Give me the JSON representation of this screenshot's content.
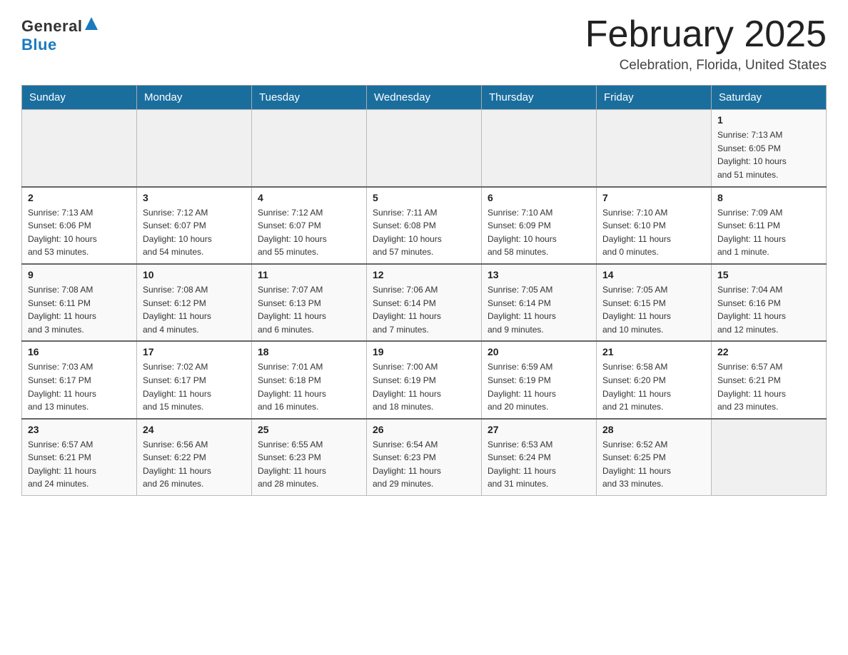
{
  "logo": {
    "general": "General",
    "blue": "Blue"
  },
  "header": {
    "month": "February 2025",
    "location": "Celebration, Florida, United States"
  },
  "days_of_week": [
    "Sunday",
    "Monday",
    "Tuesday",
    "Wednesday",
    "Thursday",
    "Friday",
    "Saturday"
  ],
  "weeks": [
    [
      {
        "day": "",
        "info": ""
      },
      {
        "day": "",
        "info": ""
      },
      {
        "day": "",
        "info": ""
      },
      {
        "day": "",
        "info": ""
      },
      {
        "day": "",
        "info": ""
      },
      {
        "day": "",
        "info": ""
      },
      {
        "day": "1",
        "info": "Sunrise: 7:13 AM\nSunset: 6:05 PM\nDaylight: 10 hours\nand 51 minutes."
      }
    ],
    [
      {
        "day": "2",
        "info": "Sunrise: 7:13 AM\nSunset: 6:06 PM\nDaylight: 10 hours\nand 53 minutes."
      },
      {
        "day": "3",
        "info": "Sunrise: 7:12 AM\nSunset: 6:07 PM\nDaylight: 10 hours\nand 54 minutes."
      },
      {
        "day": "4",
        "info": "Sunrise: 7:12 AM\nSunset: 6:07 PM\nDaylight: 10 hours\nand 55 minutes."
      },
      {
        "day": "5",
        "info": "Sunrise: 7:11 AM\nSunset: 6:08 PM\nDaylight: 10 hours\nand 57 minutes."
      },
      {
        "day": "6",
        "info": "Sunrise: 7:10 AM\nSunset: 6:09 PM\nDaylight: 10 hours\nand 58 minutes."
      },
      {
        "day": "7",
        "info": "Sunrise: 7:10 AM\nSunset: 6:10 PM\nDaylight: 11 hours\nand 0 minutes."
      },
      {
        "day": "8",
        "info": "Sunrise: 7:09 AM\nSunset: 6:11 PM\nDaylight: 11 hours\nand 1 minute."
      }
    ],
    [
      {
        "day": "9",
        "info": "Sunrise: 7:08 AM\nSunset: 6:11 PM\nDaylight: 11 hours\nand 3 minutes."
      },
      {
        "day": "10",
        "info": "Sunrise: 7:08 AM\nSunset: 6:12 PM\nDaylight: 11 hours\nand 4 minutes."
      },
      {
        "day": "11",
        "info": "Sunrise: 7:07 AM\nSunset: 6:13 PM\nDaylight: 11 hours\nand 6 minutes."
      },
      {
        "day": "12",
        "info": "Sunrise: 7:06 AM\nSunset: 6:14 PM\nDaylight: 11 hours\nand 7 minutes."
      },
      {
        "day": "13",
        "info": "Sunrise: 7:05 AM\nSunset: 6:14 PM\nDaylight: 11 hours\nand 9 minutes."
      },
      {
        "day": "14",
        "info": "Sunrise: 7:05 AM\nSunset: 6:15 PM\nDaylight: 11 hours\nand 10 minutes."
      },
      {
        "day": "15",
        "info": "Sunrise: 7:04 AM\nSunset: 6:16 PM\nDaylight: 11 hours\nand 12 minutes."
      }
    ],
    [
      {
        "day": "16",
        "info": "Sunrise: 7:03 AM\nSunset: 6:17 PM\nDaylight: 11 hours\nand 13 minutes."
      },
      {
        "day": "17",
        "info": "Sunrise: 7:02 AM\nSunset: 6:17 PM\nDaylight: 11 hours\nand 15 minutes."
      },
      {
        "day": "18",
        "info": "Sunrise: 7:01 AM\nSunset: 6:18 PM\nDaylight: 11 hours\nand 16 minutes."
      },
      {
        "day": "19",
        "info": "Sunrise: 7:00 AM\nSunset: 6:19 PM\nDaylight: 11 hours\nand 18 minutes."
      },
      {
        "day": "20",
        "info": "Sunrise: 6:59 AM\nSunset: 6:19 PM\nDaylight: 11 hours\nand 20 minutes."
      },
      {
        "day": "21",
        "info": "Sunrise: 6:58 AM\nSunset: 6:20 PM\nDaylight: 11 hours\nand 21 minutes."
      },
      {
        "day": "22",
        "info": "Sunrise: 6:57 AM\nSunset: 6:21 PM\nDaylight: 11 hours\nand 23 minutes."
      }
    ],
    [
      {
        "day": "23",
        "info": "Sunrise: 6:57 AM\nSunset: 6:21 PM\nDaylight: 11 hours\nand 24 minutes."
      },
      {
        "day": "24",
        "info": "Sunrise: 6:56 AM\nSunset: 6:22 PM\nDaylight: 11 hours\nand 26 minutes."
      },
      {
        "day": "25",
        "info": "Sunrise: 6:55 AM\nSunset: 6:23 PM\nDaylight: 11 hours\nand 28 minutes."
      },
      {
        "day": "26",
        "info": "Sunrise: 6:54 AM\nSunset: 6:23 PM\nDaylight: 11 hours\nand 29 minutes."
      },
      {
        "day": "27",
        "info": "Sunrise: 6:53 AM\nSunset: 6:24 PM\nDaylight: 11 hours\nand 31 minutes."
      },
      {
        "day": "28",
        "info": "Sunrise: 6:52 AM\nSunset: 6:25 PM\nDaylight: 11 hours\nand 33 minutes."
      },
      {
        "day": "",
        "info": ""
      }
    ]
  ]
}
